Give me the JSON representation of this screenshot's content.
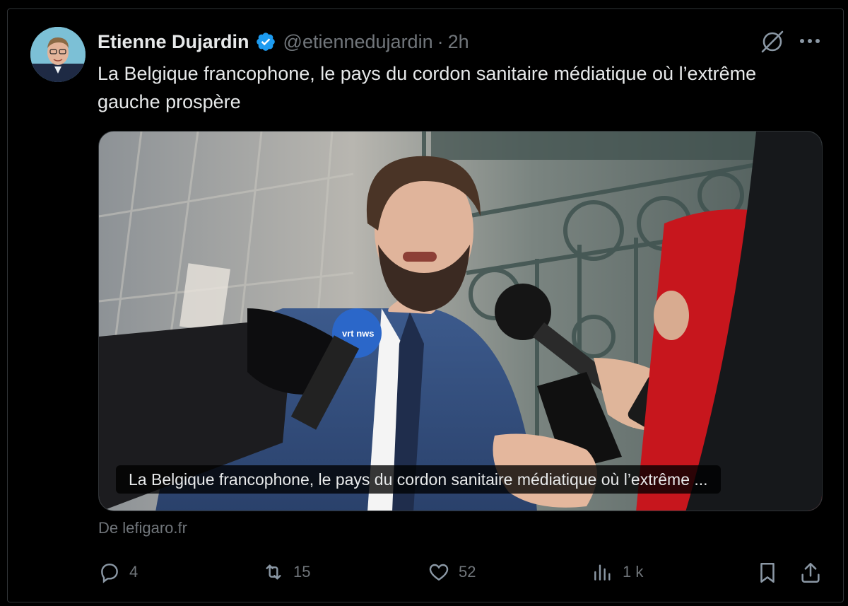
{
  "author": {
    "name": "Etienne Dujardin",
    "handle": "@etiennedujardin",
    "separator": "·",
    "time": "2h",
    "verified": true
  },
  "tweet": {
    "text": "La Belgique francophone, le pays du cordon sanitaire médiatique où l’extrême gauche prospère"
  },
  "card": {
    "caption": "La Belgique francophone, le pays du cordon sanitaire médiatique où l’extrême ...",
    "source": "De lefigaro.fr",
    "mic_brand": "vrt nws"
  },
  "actions": {
    "replies": "4",
    "reposts": "15",
    "likes": "52",
    "views": "1 k"
  },
  "icons": [
    "grok-icon",
    "more-icon",
    "reply-icon",
    "repost-icon",
    "like-icon",
    "views-icon",
    "bookmark-icon",
    "share-icon",
    "verified-badge-icon"
  ],
  "colors": {
    "background": "#000000",
    "text": "#e7e9ea",
    "muted": "#71767b",
    "verified": "#1d9bf0",
    "border": "#2f3336"
  }
}
